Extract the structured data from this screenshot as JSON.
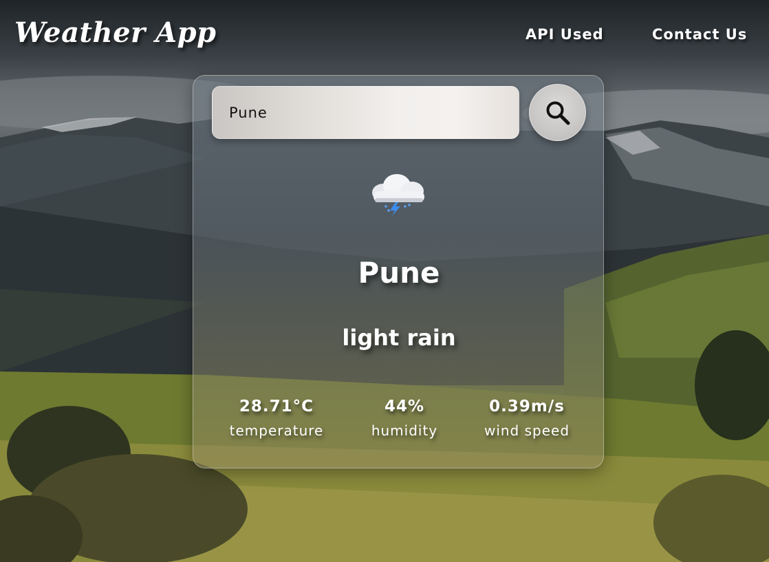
{
  "header": {
    "title": "Weather App",
    "nav": [
      {
        "label": "API Used"
      },
      {
        "label": "Contact Us"
      }
    ]
  },
  "search": {
    "value": "Pune",
    "button_icon": "search-icon"
  },
  "weather": {
    "icon": "thunderstorm-cloud-icon",
    "city": "Pune",
    "description": "light rain",
    "stats": [
      {
        "value": "28.71°C",
        "label": "temperature"
      },
      {
        "value": "44%",
        "label": "humidity"
      },
      {
        "value": "0.39m/s",
        "label": "wind speed"
      }
    ]
  },
  "colors": {
    "text": "#ffffff",
    "card_border": "#d9d9d9",
    "search_icon": "#111111"
  }
}
